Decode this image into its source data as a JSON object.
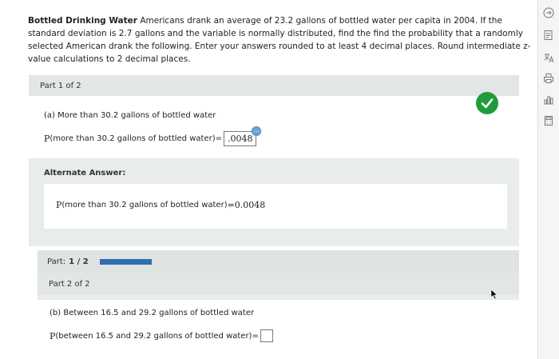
{
  "problem": {
    "topic": "Bottled Drinking Water",
    "text": "Americans drank an average of 23.2 gallons of bottled water per capita in 2004. If the standard deviation is 2.7 gallons and the variable is normally distributed, find the find the probability that a randomly selected American drank the following. Enter your answers rounded to at least 4 decimal places. Round intermediate z-value calculations to 2 decimal places."
  },
  "part1": {
    "header": "Part 1 of 2",
    "question": "(a) More than 30.2 gallons of bottled water",
    "eq_prefix": "P",
    "eq_label": "(more than 30.2 gallons of bottled water)",
    "eq_sign": "=",
    "answer": ".0048",
    "alt_label": "Alternate Answer:",
    "alt_prefix": "P",
    "alt_label_text": "(more than 30.2 gallons of bottled water)",
    "alt_value": "=0.0048"
  },
  "progress": {
    "label": "Part:",
    "value": "1 / 2",
    "fraction": 0.5
  },
  "part2": {
    "header": "Part 2 of 2",
    "question": "(b) Between 16.5 and 29.2 gallons of bottled water",
    "eq_prefix": "P",
    "eq_label": "(between 16.5 and 29.2 gallons of bottled water)",
    "eq_sign": "="
  },
  "sidebar": {
    "icons": [
      "arrow-icon",
      "document-icon",
      "translate-icon",
      "print-icon",
      "chart-icon",
      "calculator-icon"
    ]
  },
  "colors": {
    "panel": "#e8ecea",
    "progress_fill": "#2d6fb1",
    "check": "#1f9b3c"
  }
}
